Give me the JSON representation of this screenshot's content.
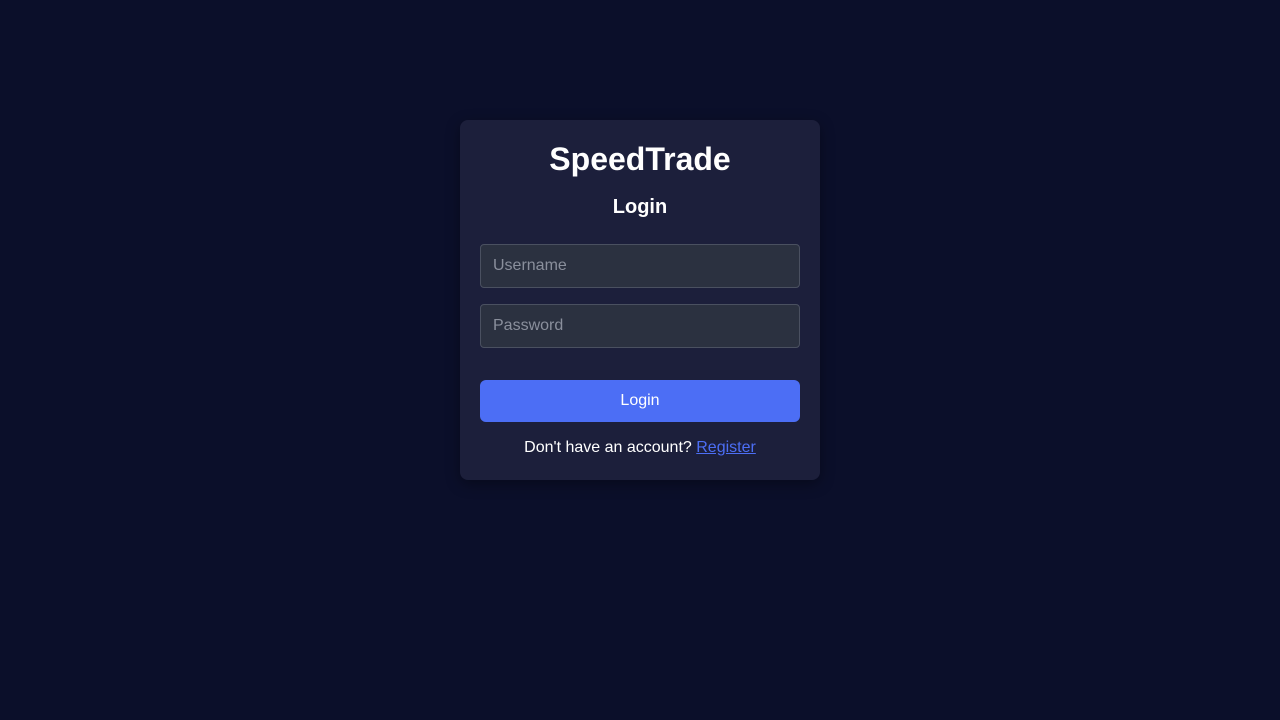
{
  "app": {
    "brand": "SpeedTrade"
  },
  "login_form": {
    "title": "Login",
    "username_placeholder": "Username",
    "username_value": "",
    "password_placeholder": "Password",
    "password_value": "",
    "submit_label": "Login",
    "register_prompt": "Don't have an account?",
    "register_link": "Register"
  },
  "colors": {
    "background": "#0b0f2a",
    "card": "#1c1f3b",
    "input_background": "#2b3140",
    "accent": "#4c6ef5",
    "text": "#ffffff"
  }
}
